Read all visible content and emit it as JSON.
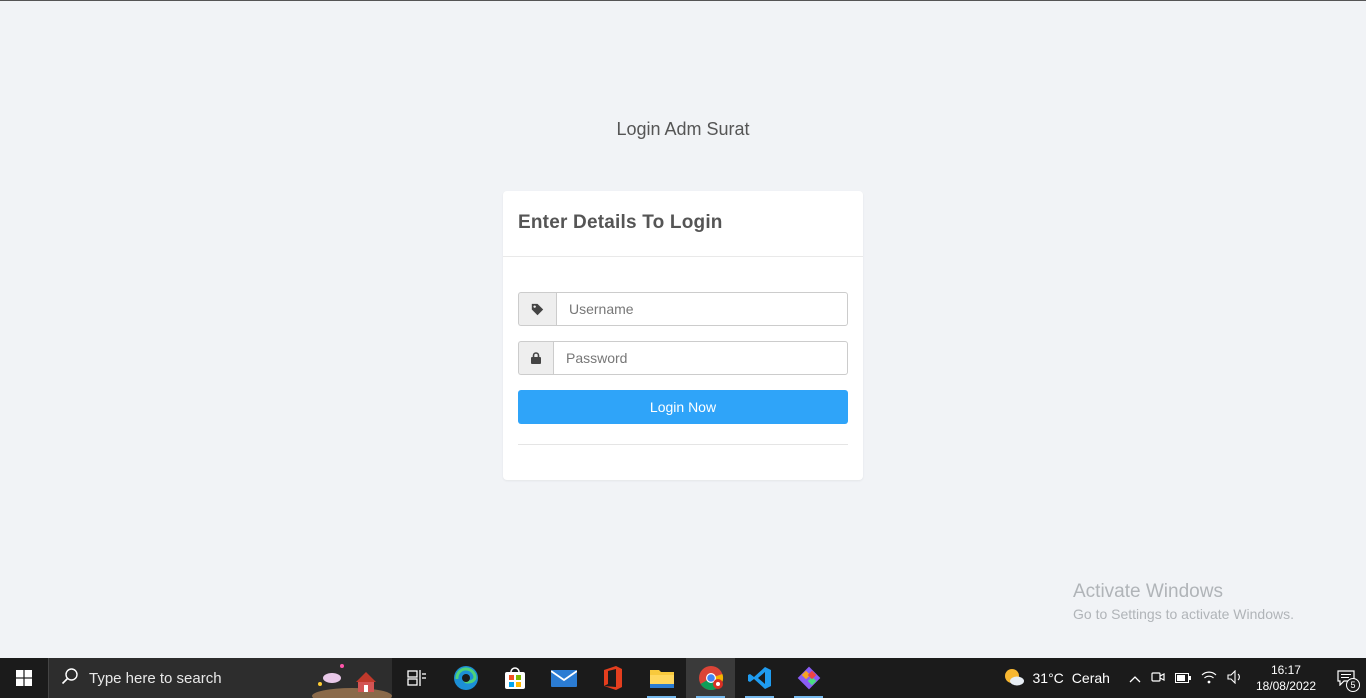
{
  "page": {
    "title": "Login Adm Surat"
  },
  "login_card": {
    "heading": "Enter Details To Login",
    "username_placeholder": "Username",
    "password_placeholder": "Password",
    "submit_label": "Login Now"
  },
  "watermark": {
    "line1": "Activate Windows",
    "line2": "Go to Settings to activate Windows."
  },
  "taskbar": {
    "search_placeholder": "Type here to search",
    "apps": [
      "task-view",
      "edge",
      "store",
      "mail",
      "office",
      "file-explorer",
      "chrome",
      "vscode",
      "git"
    ],
    "active_app": "chrome",
    "weather": {
      "temp": "31°C",
      "condition": "Cerah"
    },
    "time": "16:17",
    "date": "18/08/2022",
    "notification_count": "5"
  },
  "colors": {
    "accent": "#2fa4f9",
    "background": "#f1f3f6",
    "taskbar": "#1b1b1b"
  }
}
